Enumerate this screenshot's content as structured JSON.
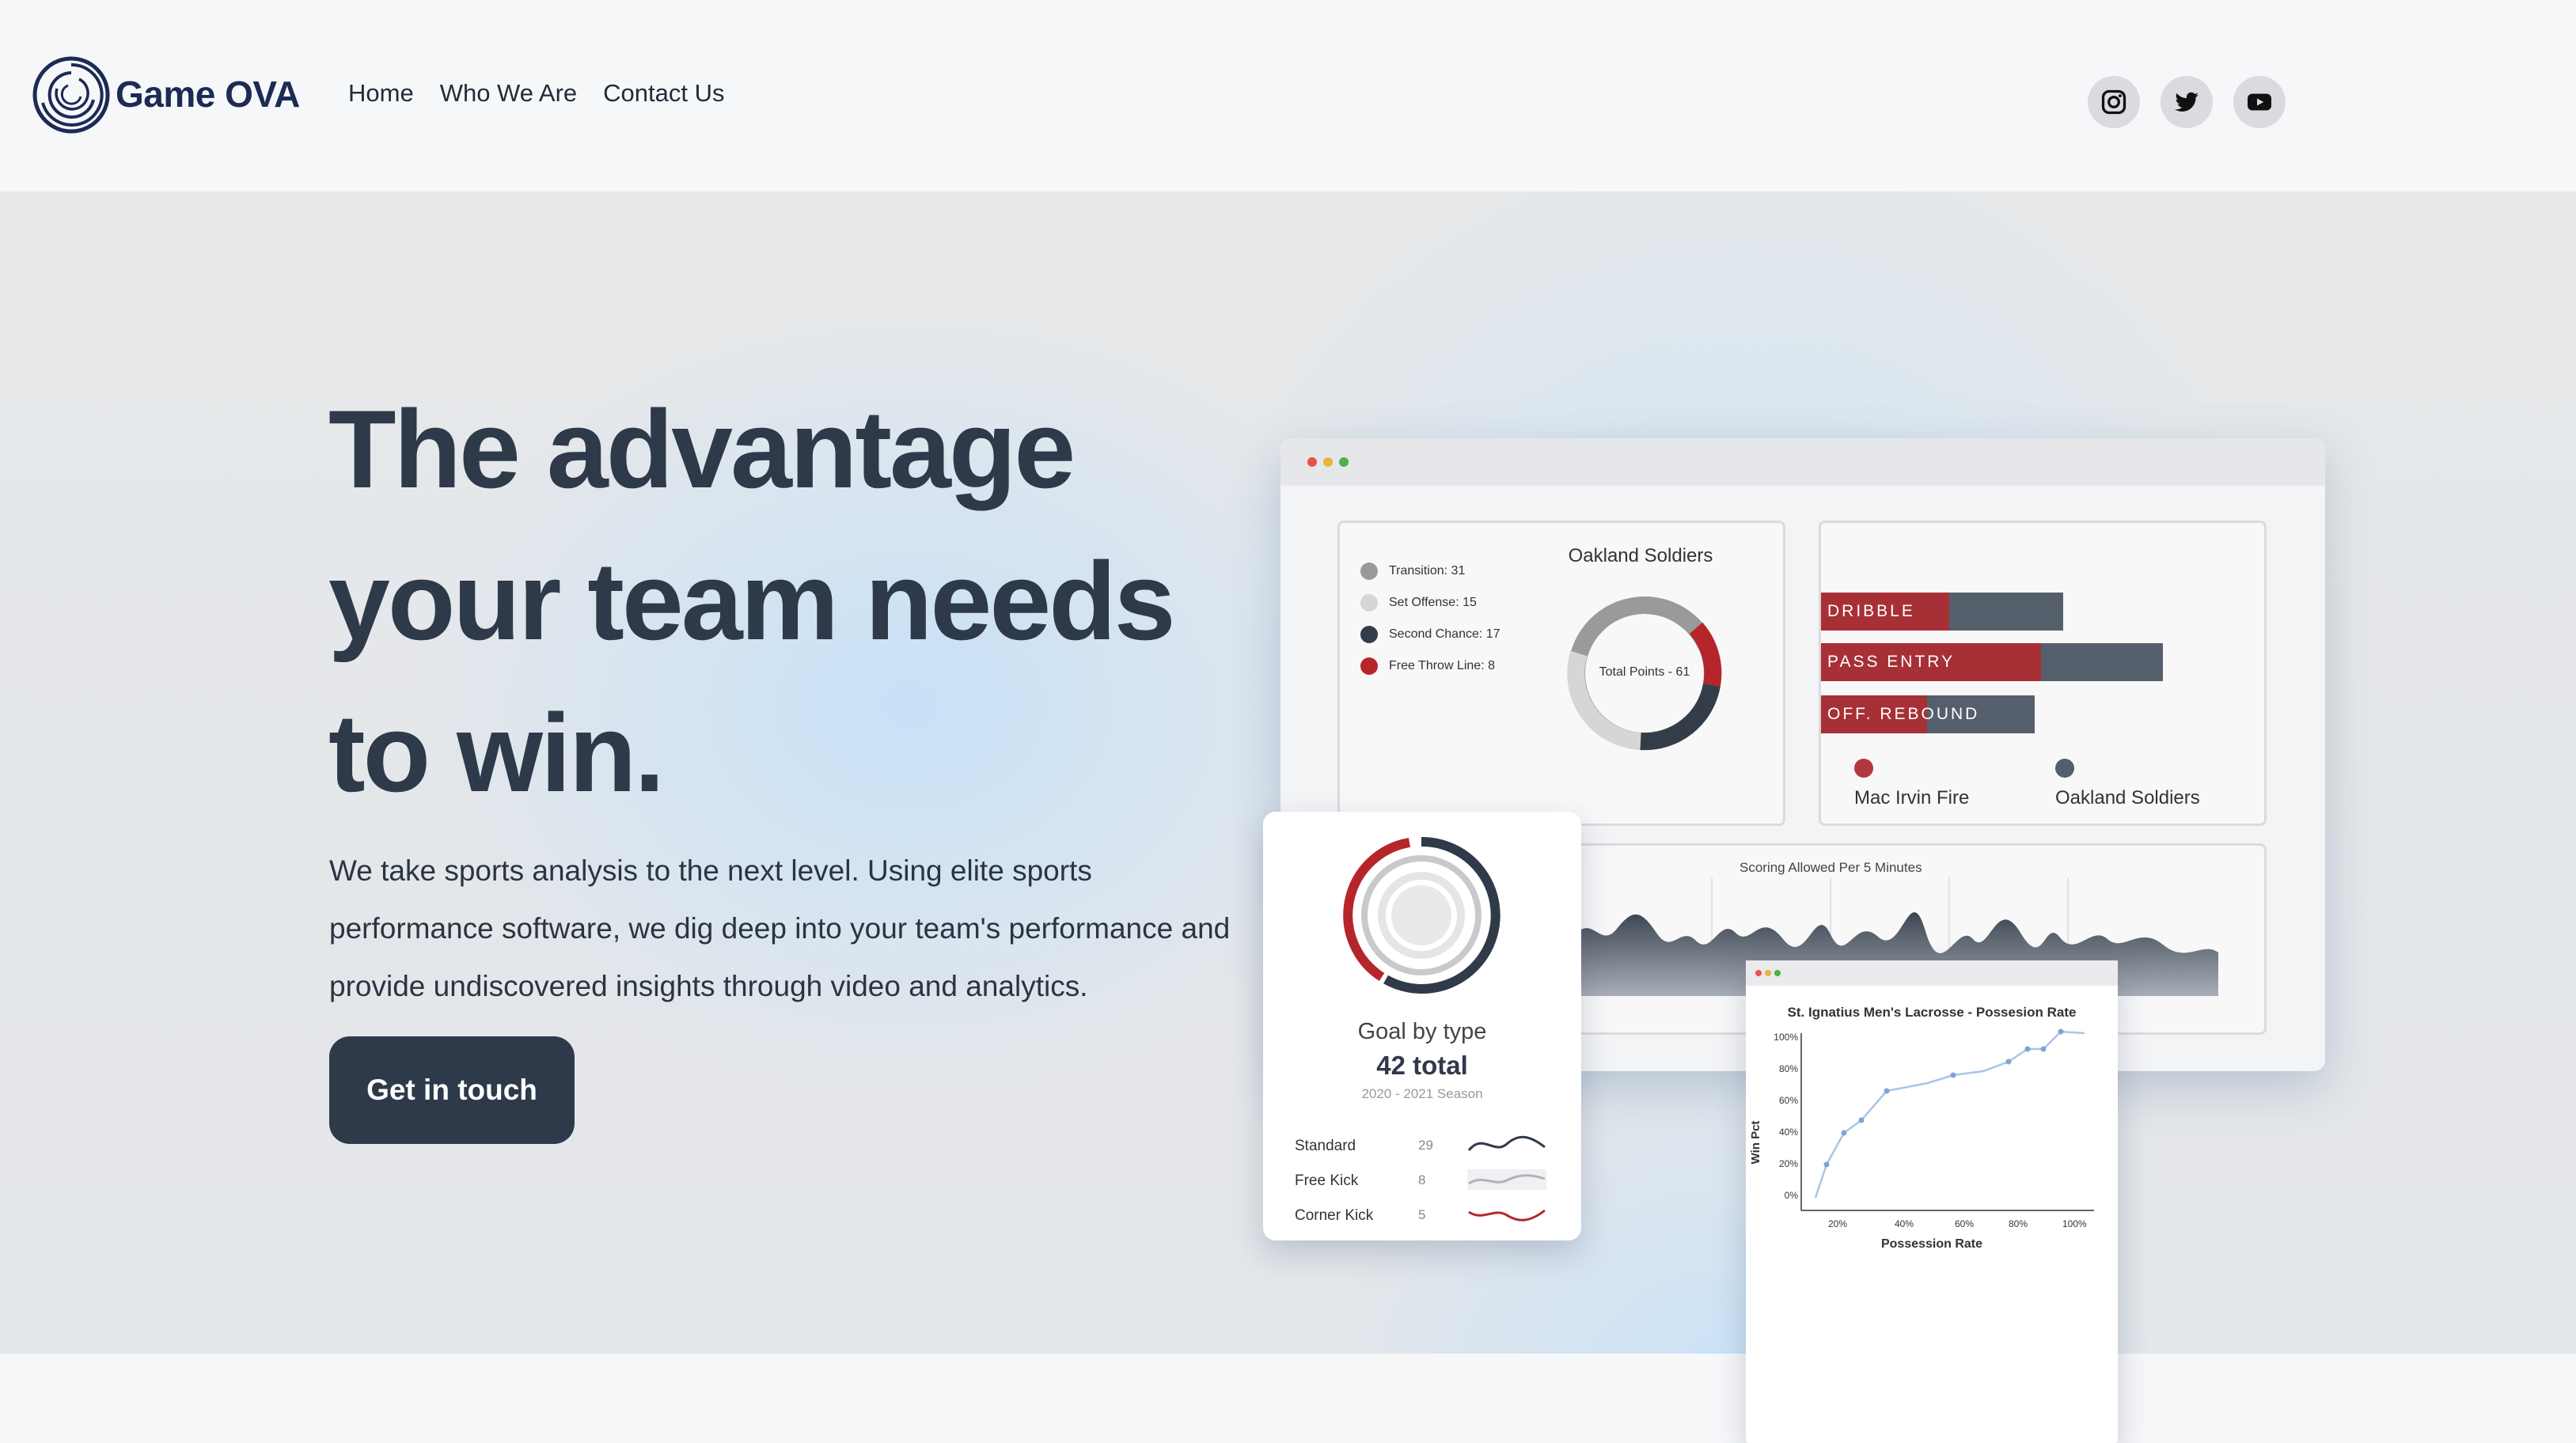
{
  "brand": {
    "name": "Game OVA"
  },
  "nav": {
    "items": [
      "Home",
      "Who We Are",
      "Contact Us"
    ]
  },
  "social": {
    "icons": [
      "instagram-icon",
      "twitter-icon",
      "youtube-icon"
    ]
  },
  "hero": {
    "headline_lines": [
      "The advantage",
      "your team needs",
      "to win."
    ],
    "description": "We take sports analysis to the next level. Using elite sports performance software, we dig deep into your team's performance and provide undiscovered insights through video and analytics.",
    "cta": "Get in touch"
  },
  "dashboard": {
    "donut": {
      "title": "Oakland Soldiers",
      "center": "Total Points - 61",
      "legend": [
        "Transition: 31",
        "Set Offense: 15",
        "Second Chance: 17",
        "Free Throw Line: 8"
      ],
      "colors": [
        "#9a9a9a",
        "#d6d6d6",
        "#333d4a",
        "#b5262b"
      ]
    },
    "bars": {
      "labels": [
        "DRIBBLE",
        "PASS ENTRY",
        "OFF. REBOUND"
      ],
      "legend": [
        "Mac Irvin Fire",
        "Oakland Soldiers"
      ],
      "colors": [
        "#b3383d",
        "#545d6a"
      ]
    },
    "area": {
      "title": "Scoring Allowed Per 5 Minutes"
    },
    "goal_card": {
      "title": "Goal by type",
      "total": "42 total",
      "season": "2020 - 2021 Season",
      "rows": [
        {
          "label": "Standard",
          "value": "29"
        },
        {
          "label": "Free Kick",
          "value": "8"
        },
        {
          "label": "Corner Kick",
          "value": "5"
        }
      ]
    },
    "line_card": {
      "title": "St. Ignatius Men's Lacrosse - Possesion Rate",
      "ylabel": "Win Pct",
      "xlabel": "Possession Rate",
      "yticks": [
        "100%",
        "80%",
        "60%",
        "40%",
        "20%",
        "0%"
      ],
      "xticks": [
        "20%",
        "40%",
        "60%",
        "80%",
        "100%"
      ]
    }
  }
}
